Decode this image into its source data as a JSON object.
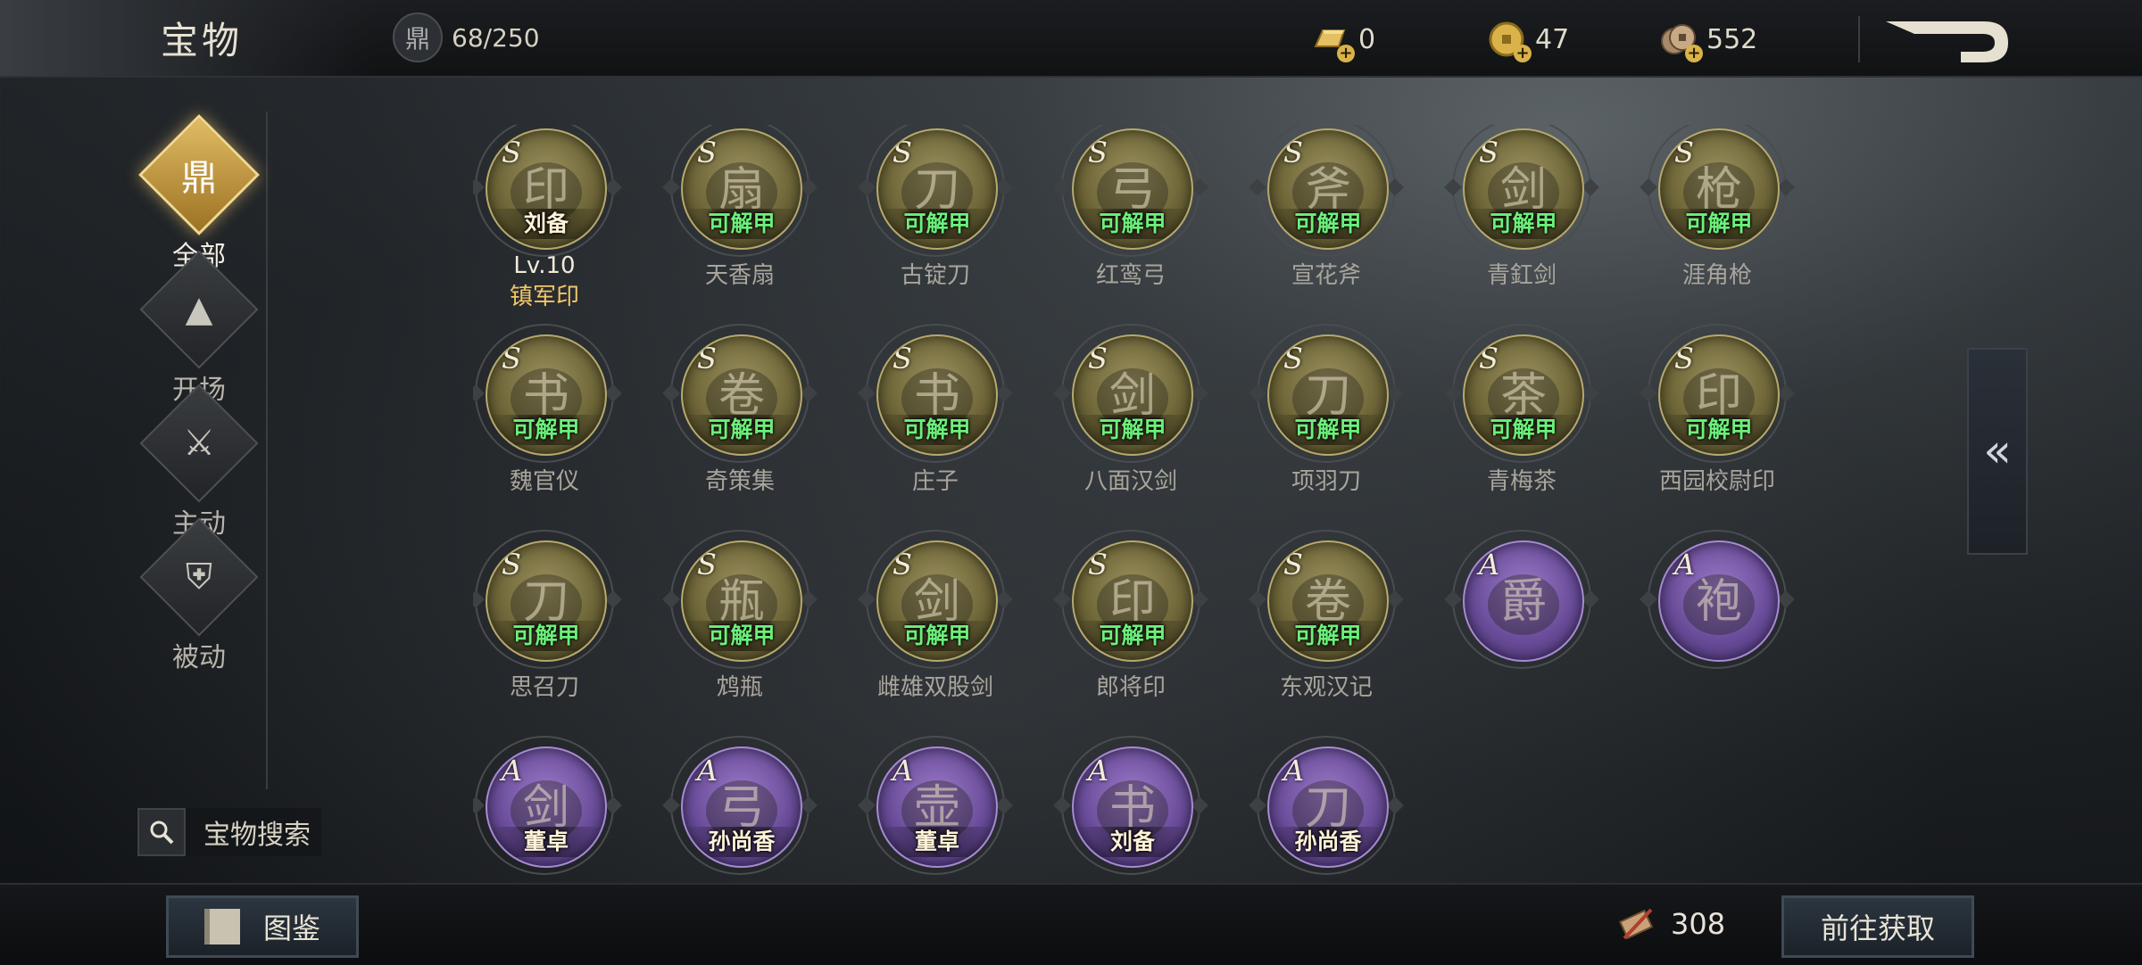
{
  "header": {
    "title": "宝物",
    "capacity": "68/250",
    "resources": [
      {
        "icon": "gold-bar-icon",
        "value": "0"
      },
      {
        "icon": "gold-coin-icon",
        "value": "47"
      },
      {
        "icon": "copper-coin-icon",
        "value": "552"
      }
    ]
  },
  "sidebar": {
    "categories": [
      {
        "label": "全部",
        "icon": "cauldron-icon",
        "active": true
      },
      {
        "label": "开场",
        "icon": "pyramid-icon",
        "active": false
      },
      {
        "label": "主动",
        "icon": "axe-icon",
        "active": false
      },
      {
        "label": "被动",
        "icon": "armor-icon",
        "active": false
      }
    ],
    "search_label": "宝物搜索"
  },
  "items": [
    {
      "grade": "S",
      "tag": "刘备",
      "tag_color": "white",
      "level": "Lv.10",
      "name": "镇军印",
      "icon": "seal-icon"
    },
    {
      "grade": "S",
      "tag": "可解甲",
      "tag_color": "green",
      "name": "天香扇",
      "icon": "fan-icon"
    },
    {
      "grade": "S",
      "tag": "可解甲",
      "tag_color": "green",
      "name": "古锭刀",
      "icon": "blade-icon"
    },
    {
      "grade": "S",
      "tag": "可解甲",
      "tag_color": "green",
      "name": "红鸾弓",
      "icon": "bow-icon"
    },
    {
      "grade": "S",
      "tag": "可解甲",
      "tag_color": "green",
      "name": "宣花斧",
      "icon": "axe-icon"
    },
    {
      "grade": "S",
      "tag": "可解甲",
      "tag_color": "green",
      "name": "青釭剑",
      "icon": "sword-icon"
    },
    {
      "grade": "S",
      "tag": "可解甲",
      "tag_color": "green",
      "name": "涯角枪",
      "icon": "spear-icon"
    },
    {
      "grade": "S",
      "tag": "可解甲",
      "tag_color": "green",
      "name": "魏官仪",
      "icon": "book-icon"
    },
    {
      "grade": "S",
      "tag": "可解甲",
      "tag_color": "green",
      "name": "奇策集",
      "icon": "scroll-icon"
    },
    {
      "grade": "S",
      "tag": "可解甲",
      "tag_color": "green",
      "name": "庄子",
      "icon": "book-icon"
    },
    {
      "grade": "S",
      "tag": "可解甲",
      "tag_color": "green",
      "name": "八面汉剑",
      "icon": "sword-icon"
    },
    {
      "grade": "S",
      "tag": "可解甲",
      "tag_color": "green",
      "name": "项羽刀",
      "icon": "blade-icon"
    },
    {
      "grade": "S",
      "tag": "可解甲",
      "tag_color": "green",
      "name": "青梅茶",
      "icon": "tea-bowl-icon"
    },
    {
      "grade": "S",
      "tag": "可解甲",
      "tag_color": "green",
      "name": "西园校尉印",
      "icon": "seal-icon"
    },
    {
      "grade": "S",
      "tag": "可解甲",
      "tag_color": "green",
      "name": "思召刀",
      "icon": "blade-icon"
    },
    {
      "grade": "S",
      "tag": "可解甲",
      "tag_color": "green",
      "name": "鸩瓶",
      "icon": "vase-icon"
    },
    {
      "grade": "S",
      "tag": "可解甲",
      "tag_color": "green",
      "name": "雌雄双股剑",
      "icon": "twin-sword-icon"
    },
    {
      "grade": "S",
      "tag": "可解甲",
      "tag_color": "green",
      "name": "郎将印",
      "icon": "turtle-seal-icon"
    },
    {
      "grade": "S",
      "tag": "可解甲",
      "tag_color": "green",
      "name": "东观汉记",
      "icon": "scroll-icon"
    },
    {
      "grade": "A",
      "tag": "",
      "tag_color": "white",
      "name": "",
      "icon": "goblet-icon"
    },
    {
      "grade": "A",
      "tag": "",
      "tag_color": "white",
      "name": "",
      "icon": "robe-icon"
    },
    {
      "grade": "A",
      "tag": "董卓",
      "tag_color": "white",
      "name": "",
      "icon": "sword-icon"
    },
    {
      "grade": "A",
      "tag": "孙尚香",
      "tag_color": "white",
      "name": "",
      "icon": "bow-icon"
    },
    {
      "grade": "A",
      "tag": "董卓",
      "tag_color": "white",
      "name": "",
      "icon": "wine-gourd-icon"
    },
    {
      "grade": "A",
      "tag": "刘备",
      "tag_color": "white",
      "name": "",
      "icon": "book-icon"
    },
    {
      "grade": "A",
      "tag": "孙尚香",
      "tag_color": "white",
      "name": "",
      "icon": "blade-icon"
    }
  ],
  "footer": {
    "codex_label": "图鉴",
    "token_count": "308",
    "go_label": "前往获取"
  },
  "colors": {
    "accent_gold": "#e2bc64",
    "tag_green": "#6cf07a",
    "grade_s": "#8a7e4a",
    "grade_a": "#6a4d9a"
  }
}
